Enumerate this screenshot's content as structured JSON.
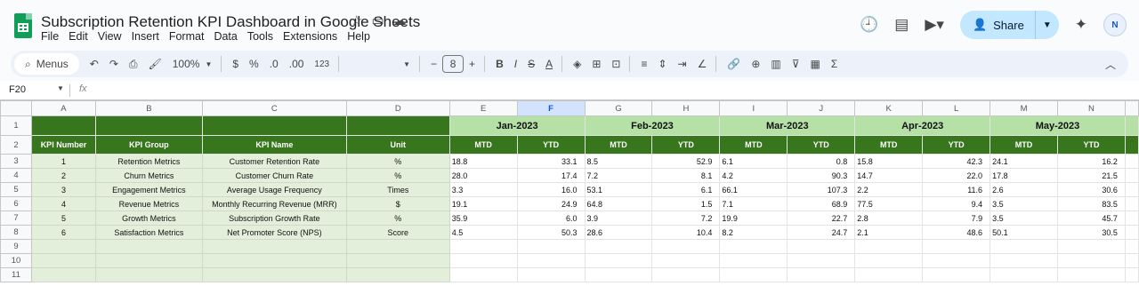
{
  "app": {
    "title": "Subscription Retention KPI Dashboard in Google Sheets",
    "menu": [
      "File",
      "Edit",
      "View",
      "Insert",
      "Format",
      "Data",
      "Tools",
      "Extensions",
      "Help"
    ],
    "share_label": "Share",
    "avatar_text": "N"
  },
  "toolbar": {
    "search_label": "Menus",
    "zoom": "100%",
    "currency": "$",
    "percent": "%",
    "dec_decrease": ".0",
    "dec_increase": ".00",
    "number_format": "123",
    "font_size": "8",
    "bold": "B",
    "italic": "I",
    "strike": "S",
    "text_color": "A"
  },
  "formula_bar": {
    "cell_ref": "F20",
    "fx": "fx"
  },
  "sheet": {
    "columns": [
      "A",
      "B",
      "C",
      "D",
      "E",
      "F",
      "G",
      "H",
      "I",
      "J",
      "K",
      "L",
      "M",
      "N"
    ],
    "selected_column": "F",
    "row_numbers": [
      "1",
      "2",
      "3",
      "4",
      "5",
      "6",
      "7",
      "8",
      "9",
      "10",
      "11"
    ],
    "months": [
      "Jan-2023",
      "Feb-2023",
      "Mar-2023",
      "Apr-2023",
      "May-2023"
    ],
    "headers": [
      "KPI Number",
      "KPI Group",
      "KPI Name",
      "Unit"
    ],
    "sub_headers": [
      "MTD",
      "YTD"
    ],
    "rows": [
      {
        "num": "1",
        "group": "Retention Metrics",
        "name": "Customer Retention Rate",
        "unit": "%",
        "vals": [
          "18.8",
          "33.1",
          "8.5",
          "52.9",
          "6.1",
          "0.8",
          "15.8",
          "42.3",
          "24.1",
          "16.2"
        ]
      },
      {
        "num": "2",
        "group": "Churn Metrics",
        "name": "Customer Churn Rate",
        "unit": "%",
        "vals": [
          "28.0",
          "17.4",
          "7.2",
          "8.1",
          "4.2",
          "90.3",
          "14.7",
          "22.0",
          "17.8",
          "21.5"
        ]
      },
      {
        "num": "3",
        "group": "Engagement Metrics",
        "name": "Average Usage Frequency",
        "unit": "Times",
        "vals": [
          "3.3",
          "16.0",
          "53.1",
          "6.1",
          "66.1",
          "107.3",
          "2.2",
          "11.6",
          "2.6",
          "30.6"
        ]
      },
      {
        "num": "4",
        "group": "Revenue Metrics",
        "name": "Monthly Recurring Revenue (MRR)",
        "unit": "$",
        "vals": [
          "19.1",
          "24.9",
          "64.8",
          "1.5",
          "7.1",
          "68.9",
          "77.5",
          "9.4",
          "3.5",
          "83.5"
        ]
      },
      {
        "num": "5",
        "group": "Growth Metrics",
        "name": "Subscription Growth Rate",
        "unit": "%",
        "vals": [
          "35.9",
          "6.0",
          "3.9",
          "7.2",
          "19.9",
          "22.7",
          "2.8",
          "7.9",
          "3.5",
          "45.7"
        ]
      },
      {
        "num": "6",
        "group": "Satisfaction Metrics",
        "name": "Net Promoter Score (NPS)",
        "unit": "Score",
        "vals": [
          "4.5",
          "50.3",
          "28.6",
          "10.4",
          "8.2",
          "24.7",
          "2.1",
          "48.6",
          "50.1",
          "30.5"
        ]
      }
    ]
  }
}
